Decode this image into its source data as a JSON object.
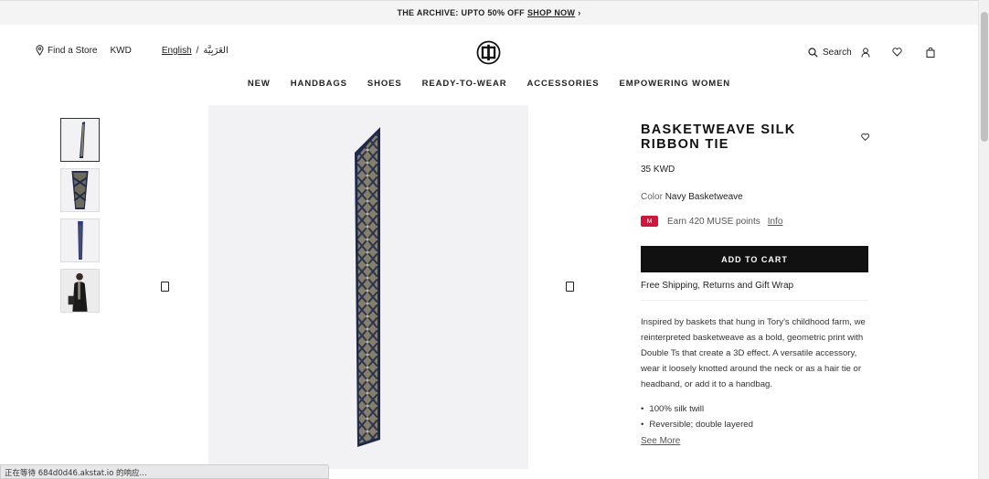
{
  "promo": {
    "text": "THE ARCHIVE: UPTO 50% OFF",
    "link": "SHOP NOW",
    "chevron": "›"
  },
  "header": {
    "find_store": "Find a Store",
    "currency": "KWD",
    "lang_en": "English",
    "lang_sep": "/",
    "lang_ar": "العَرَبِيَّة",
    "search": "Search",
    "icons": [
      "pin-icon",
      "search-icon",
      "account-icon",
      "heart-icon",
      "bag-icon"
    ]
  },
  "nav": [
    "NEW",
    "HANDBAGS",
    "SHOES",
    "READY-TO-WEAR",
    "ACCESSORIES",
    "EMPOWERING WOMEN"
  ],
  "product": {
    "title": "BASKETWEAVE SILK RIBBON TIE",
    "price": "35 KWD",
    "color_label": "Color",
    "color_value": "Navy Basketweave",
    "muse_badge": "M",
    "muse_text": "Earn 420 MUSE points",
    "muse_info": "Info",
    "add_to_cart": "ADD TO CART",
    "shipping": "Free Shipping, Returns and Gift Wrap",
    "description": "Inspired by baskets that hung in Tory's childhood farm, we reinterpreted basketweave as a bold, geometric print with Double Ts that create a 3D effect. A versatile accessory, wear it loosely knotted around the neck or as a hair tie or headband, or add it to a handbag.",
    "bullets": [
      "100% silk twill",
      "Reversible; double layered"
    ],
    "see_more": "See More"
  },
  "colors": {
    "navy": "#1e2a4a",
    "pattern": "#8a8470",
    "accent": "#d6143a"
  },
  "status_bar": "正在等待 684d0d46.akstat.io 的响应..."
}
